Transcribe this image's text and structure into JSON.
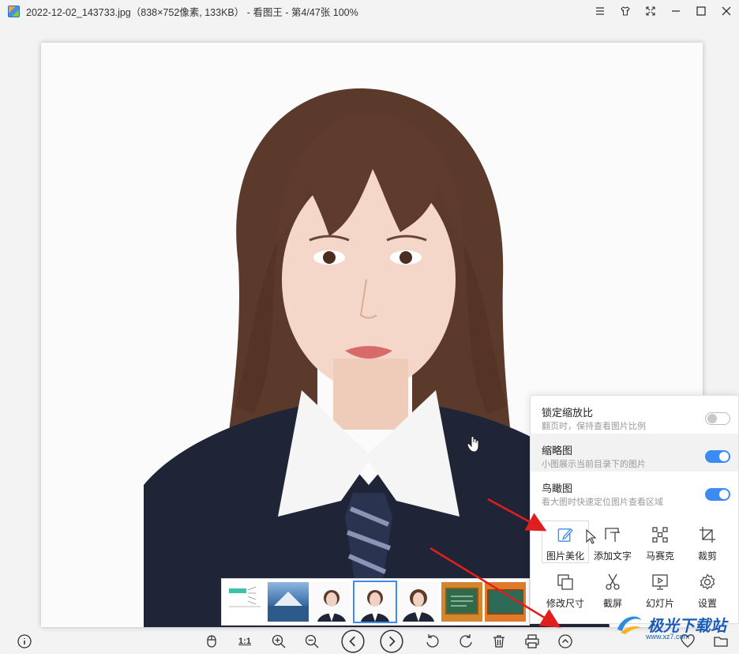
{
  "window": {
    "title": "2022-12-02_143733.jpg（838×752像素, 133KB） - 看图王 - 第4/47张 100%"
  },
  "panel": {
    "toggles": [
      {
        "title": "锁定缩放比",
        "subtitle": "翻页时，保持查看图片比例",
        "state": "off"
      },
      {
        "title": "缩略图",
        "subtitle": "小图展示当前目录下的图片",
        "state": "on"
      },
      {
        "title": "鸟瞰图",
        "subtitle": "看大图时快速定位图片查看区域",
        "state": "on"
      }
    ],
    "tools": [
      {
        "label": "图片美化",
        "icon": "edit-icon",
        "active": true
      },
      {
        "label": "添加文字",
        "icon": "add-text-icon",
        "active": false
      },
      {
        "label": "马赛克",
        "icon": "mosaic-icon",
        "active": false
      },
      {
        "label": "裁剪",
        "icon": "crop-icon",
        "active": false
      },
      {
        "label": "修改尺寸",
        "icon": "resize-icon",
        "active": false
      },
      {
        "label": "截屏",
        "icon": "scissors-icon",
        "active": false
      },
      {
        "label": "幻灯片",
        "icon": "slideshow-icon",
        "active": false
      },
      {
        "label": "设置",
        "icon": "gear-icon",
        "active": false
      }
    ]
  },
  "toolbar": {
    "actual_size_label": "1:1"
  },
  "watermark": {
    "name": "极光下载站",
    "url": "www.xz7.com"
  },
  "colors": {
    "accent": "#3c8bf0",
    "arrow": "#e01e1e",
    "background": "#f3f3f3"
  }
}
